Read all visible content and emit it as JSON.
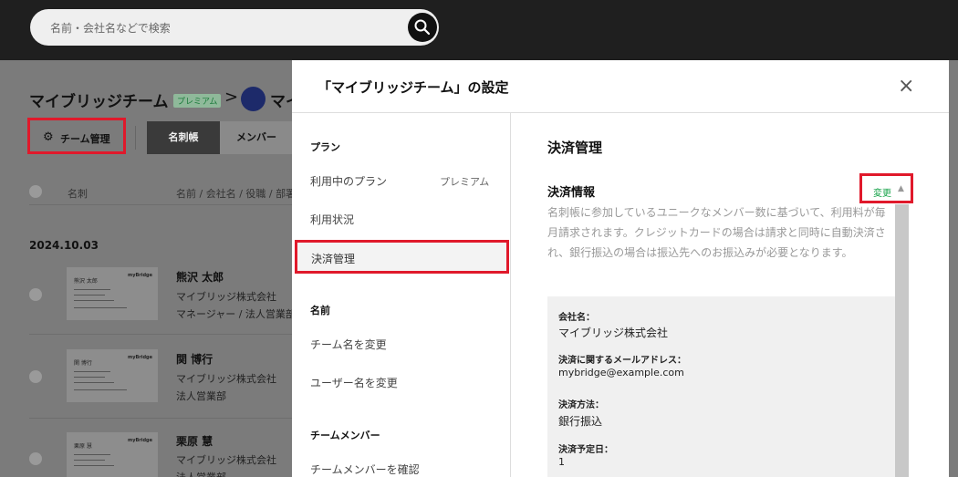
{
  "search": {
    "placeholder": "名前・会社名などで検索",
    "button_icon": "search-icon"
  },
  "background": {
    "team_title": "マイブリッジチーム",
    "badge": "プレミアム",
    "arrow": ">",
    "team_title2": "マイ",
    "team_mgmt_label": "チーム管理",
    "tabs": [
      "名刺帳",
      "メンバー"
    ],
    "col_card": "名刺",
    "col_info": "名前 / 会社名 / 役職 / 部署",
    "date": "2024.10.03",
    "rows": [
      {
        "name": "熊沢 太郎",
        "company": "マイブリッジ株式会社",
        "role": "マネージャー / 法人営業部",
        "card_name": "熊沢 太郎",
        "card_brand": "myBridge"
      },
      {
        "name": "関 博行",
        "company": "マイブリッジ株式会社",
        "role": "法人営業部",
        "card_name": "関 博行",
        "card_brand": "myBridge"
      },
      {
        "name": "栗原 慧",
        "company": "マイブリッジ株式会社",
        "role": "法人営業部",
        "card_name": "栗原 慧",
        "card_brand": "myBridge"
      }
    ]
  },
  "modal": {
    "title": "「マイブリッジチーム」の設定",
    "close": "×",
    "sidebar": {
      "plan_heading": "プラン",
      "current_plan": "利用中のプラン",
      "current_plan_value": "プレミアム",
      "usage": "利用状況",
      "payment": "決済管理",
      "name_heading": "名前",
      "rename_team": "チーム名を変更",
      "rename_user": "ユーザー名を変更",
      "member_heading": "チームメンバー",
      "check_members": "チームメンバーを確認"
    },
    "content": {
      "section_title": "決済管理",
      "info_title": "決済情報",
      "change_label": "変更",
      "description": "名刺帳に参加しているユニークなメンバー数に基づいて、利用料が毎月請求されます。クレジットカードの場合は請求と同時に自動決済され、銀行振込の場合は振込先へのお振込みが必要となります。",
      "fields": {
        "company_label": "会社名：",
        "company_value": "マイブリッジ株式会社",
        "email_label": "決済に関するメールアドレス：",
        "email_value": "mybridge@example.com",
        "method_label": "決済方法：",
        "method_value": "銀行振込",
        "date_label": "決済予定日：",
        "date_value": "1"
      }
    }
  },
  "colors": {
    "accent_red": "#e0192b",
    "accent_green": "#17a34a",
    "topbar": "#1f1f1f"
  }
}
